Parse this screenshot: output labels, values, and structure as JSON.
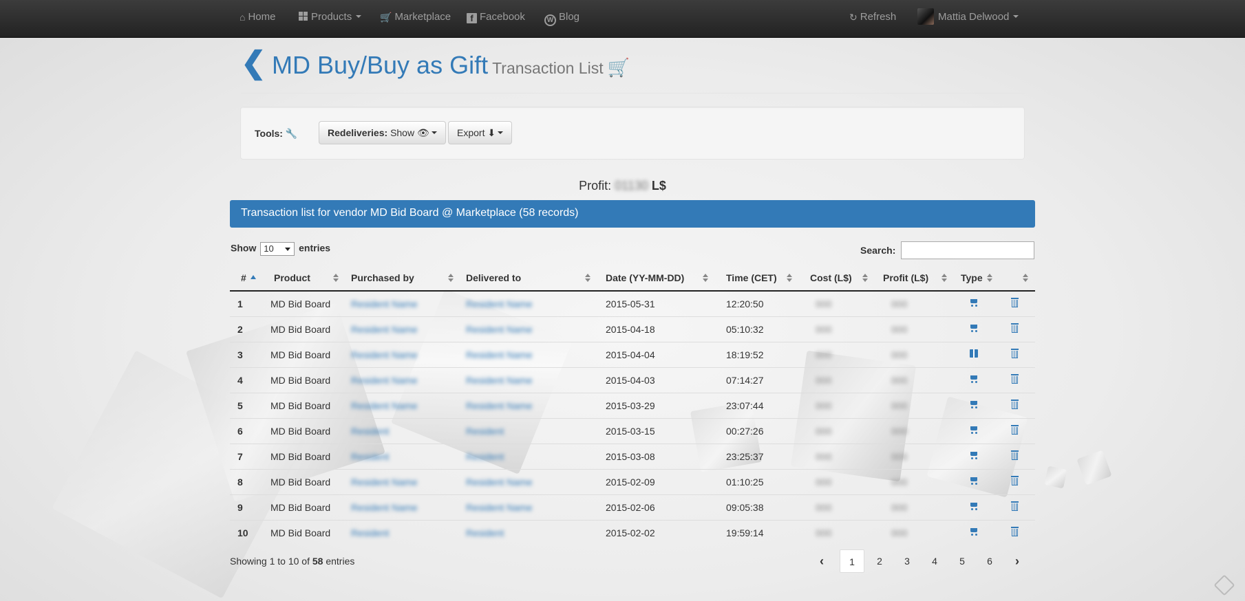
{
  "nav": {
    "home": "Home",
    "products": "Products",
    "marketplace": "Marketplace",
    "facebook": "Facebook",
    "blog": "Blog",
    "refresh": "Refresh",
    "user": "Mattia Delwood"
  },
  "header": {
    "title": "MD Buy/Buy as Gift",
    "subtitle": "Transaction List"
  },
  "tools": {
    "label": "Tools:",
    "redeliveries_label": "Redeliveries:",
    "redeliveries_value": "Show",
    "export_label": "Export"
  },
  "profit": {
    "label": "Profit:",
    "value": "01130",
    "unit": "L$"
  },
  "panel": {
    "heading": "Transaction list for vendor MD Bid Board @ Marketplace (58 records)"
  },
  "table_controls": {
    "show": "Show",
    "entries": "entries",
    "page_size": "10",
    "search_label": "Search:"
  },
  "table": {
    "columns": [
      "#",
      "Product",
      "Purchased by",
      "Delivered to",
      "Date (YY-MM-DD)",
      "Time (CET)",
      "Cost (L$)",
      "Profit (L$)",
      "Type"
    ],
    "rows": [
      {
        "n": "1",
        "product": "MD Bid Board",
        "by": "Resident Name",
        "to": "Resident Name",
        "date": "2015-05-31",
        "time": "12:20:50",
        "cost": "000",
        "profit": "000",
        "type": "cart"
      },
      {
        "n": "2",
        "product": "MD Bid Board",
        "by": "Resident Name",
        "to": "Resident Name",
        "date": "2015-04-18",
        "time": "05:10:32",
        "cost": "000",
        "profit": "000",
        "type": "cart"
      },
      {
        "n": "3",
        "product": "MD Bid Board",
        "by": "Resident Name",
        "to": "Resident Name",
        "date": "2015-04-04",
        "time": "18:19:52",
        "cost": "000",
        "profit": "000",
        "type": "gift"
      },
      {
        "n": "4",
        "product": "MD Bid Board",
        "by": "Resident Name",
        "to": "Resident Name",
        "date": "2015-04-03",
        "time": "07:14:27",
        "cost": "000",
        "profit": "000",
        "type": "cart"
      },
      {
        "n": "5",
        "product": "MD Bid Board",
        "by": "Resident Name",
        "to": "Resident Name",
        "date": "2015-03-29",
        "time": "23:07:44",
        "cost": "000",
        "profit": "000",
        "type": "cart"
      },
      {
        "n": "6",
        "product": "MD Bid Board",
        "by": "Resident",
        "to": "Resident",
        "date": "2015-03-15",
        "time": "00:27:26",
        "cost": "000",
        "profit": "000",
        "type": "cart"
      },
      {
        "n": "7",
        "product": "MD Bid Board",
        "by": "Resident",
        "to": "Resident",
        "date": "2015-03-08",
        "time": "23:25:37",
        "cost": "000",
        "profit": "000",
        "type": "cart"
      },
      {
        "n": "8",
        "product": "MD Bid Board",
        "by": "Resident Name",
        "to": "Resident Name",
        "date": "2015-02-09",
        "time": "01:10:25",
        "cost": "000",
        "profit": "000",
        "type": "cart"
      },
      {
        "n": "9",
        "product": "MD Bid Board",
        "by": "Resident Name",
        "to": "Resident Name",
        "date": "2015-02-06",
        "time": "09:05:38",
        "cost": "000",
        "profit": "000",
        "type": "cart"
      },
      {
        "n": "10",
        "product": "MD Bid Board",
        "by": "Resident",
        "to": "Resident",
        "date": "2015-02-02",
        "time": "19:59:14",
        "cost": "000",
        "profit": "000",
        "type": "cart"
      }
    ]
  },
  "footer": {
    "info_prefix": "Showing 1 to 10 of",
    "total": "58",
    "info_suffix": "entries",
    "pages": [
      "1",
      "2",
      "3",
      "4",
      "5",
      "6"
    ],
    "active_page": "1"
  },
  "colors": {
    "accent": "#337ab7",
    "navbar": "#222222"
  }
}
